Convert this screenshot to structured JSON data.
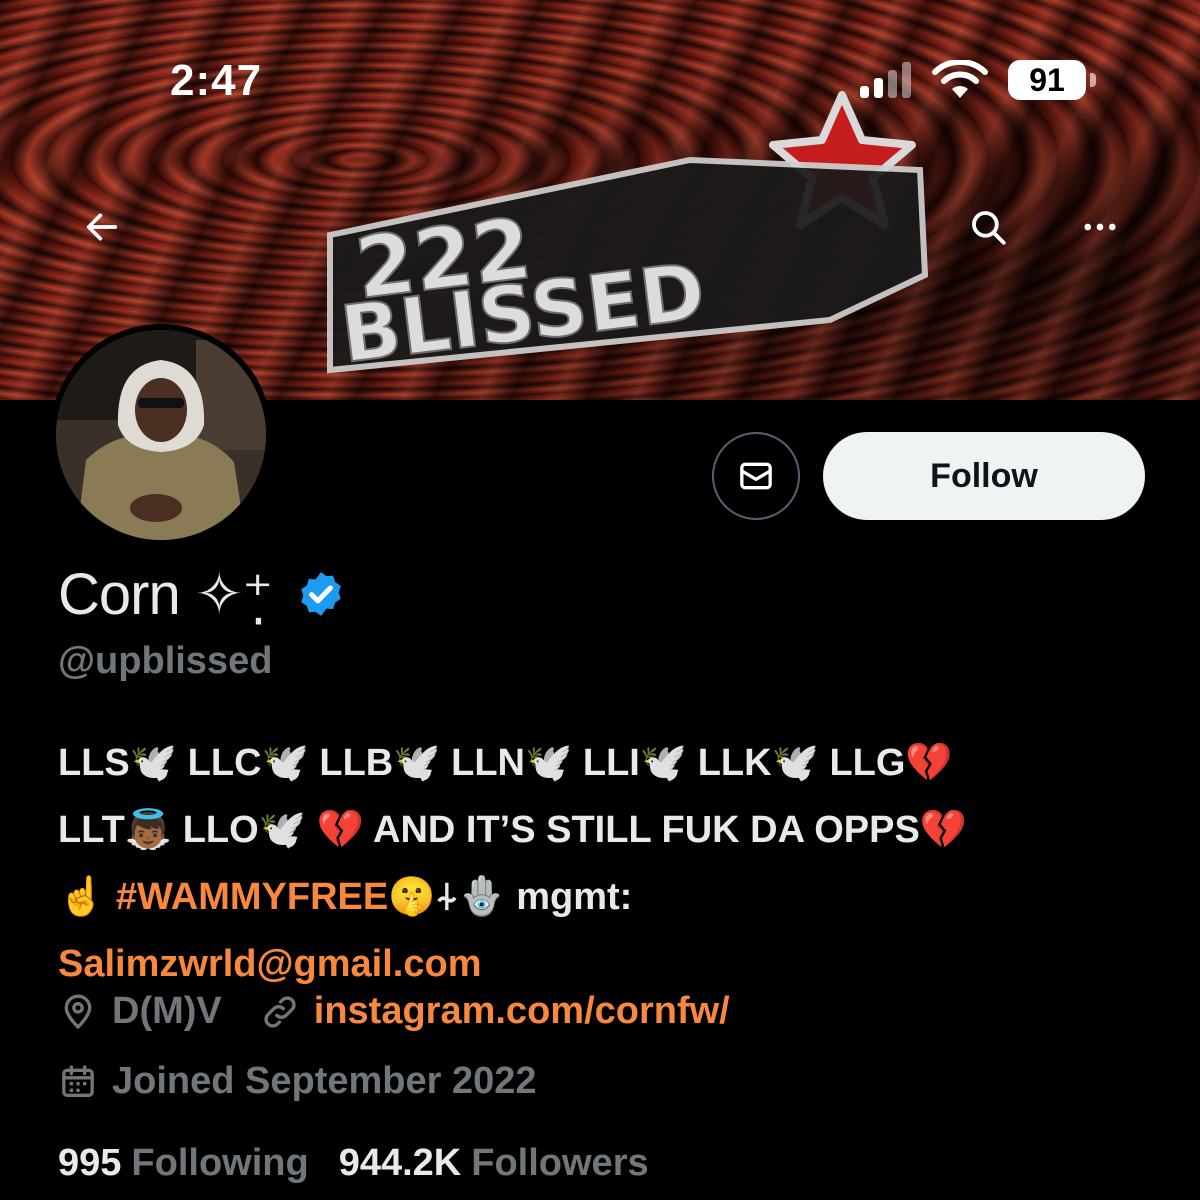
{
  "status_bar": {
    "time": "2:47",
    "battery": "91"
  },
  "banner": {
    "logo_text_top": "222",
    "logo_text_bottom": "BLISSED"
  },
  "profile": {
    "display_name": "Corn ✧⁺̣",
    "handle": "@upblissed",
    "verified": true,
    "follow_label": "Follow",
    "accent_color": "#f7883e",
    "verified_color": "#1d9bf0"
  },
  "bio": {
    "line1": "LLS🕊️ LLC🕊️ LLB🕊️ LLN🕊️ LLI🕊️ LLK🕊️ LLG💔",
    "line2": "LLT👼🏾 LLO🕊️ 💔 AND IT’S STILL FUK DA OPPS💔",
    "line3_pre": "☝️ ",
    "hashtag": "#WAMMYFREE",
    "line3_post": "🤫⍭🪬 mgmt:",
    "email": "Salimzwrld@gmail.com"
  },
  "meta": {
    "location": "D(M)V",
    "website": "instagram.com/cornfw/",
    "joined": "Joined September 2022"
  },
  "stats": {
    "following_count": "995",
    "following_label": "Following",
    "followers_count": "944.2K",
    "followers_label": "Followers"
  }
}
